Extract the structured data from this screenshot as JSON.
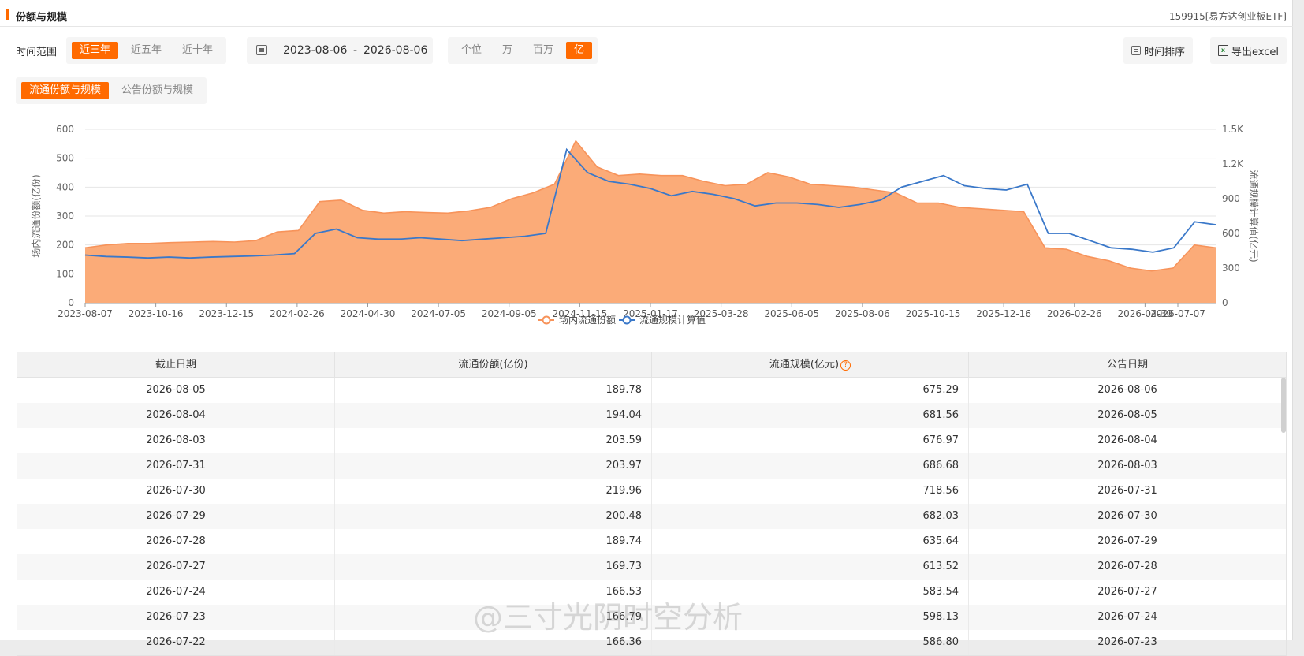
{
  "header": {
    "title": "份额与规模",
    "code": "159915[易方达创业板ETF]"
  },
  "range": {
    "label": "时间范围",
    "options": [
      "近三年",
      "近五年",
      "近十年"
    ],
    "active": 0
  },
  "date_range": {
    "start": "2023-08-06",
    "sep": "-",
    "end": "2026-08-06"
  },
  "units": {
    "options": [
      "个位",
      "万",
      "百万",
      "亿"
    ],
    "active": 3
  },
  "actions": {
    "sort": "时间排序",
    "export": "导出excel"
  },
  "chart_tabs": {
    "options": [
      "流通份额与规模",
      "公告份额与规模"
    ],
    "active": 0
  },
  "chart_data": {
    "type": "area",
    "ylabel_left": "场内流通份额(亿份)",
    "ylabel_right": "流通规模计算值(亿元)",
    "yticks_left": [
      "0",
      "100",
      "200",
      "300",
      "400",
      "500",
      "600"
    ],
    "yticks_right": [
      "0",
      "300",
      "600",
      "900",
      "1.2K",
      "1.5K"
    ],
    "ylim_left": [
      0,
      600
    ],
    "ylim_right": [
      0,
      1500
    ],
    "xticks": [
      "2023-08-07",
      "2023-10-16",
      "2023-12-15",
      "2024-02-26",
      "2024-04-30",
      "2024-07-05",
      "2024-09-05",
      "2024-11-15",
      "2025-01-17",
      "2025-03-28",
      "2025-06-05",
      "2025-08-06",
      "2025-10-15",
      "2025-12-16",
      "2026-02-26",
      "2026-04-30",
      "2026-07-07"
    ],
    "legend": [
      "场内流通份额",
      "流通规模计算值"
    ],
    "colors": {
      "share": "#f7935a",
      "share_fill": "#fbab78",
      "scale": "#3a78c9"
    },
    "series": [
      {
        "name": "场内流通份额",
        "values": [
          190,
          200,
          205,
          205,
          208,
          210,
          212,
          210,
          215,
          245,
          250,
          350,
          355,
          320,
          310,
          315,
          312,
          310,
          318,
          330,
          360,
          380,
          410,
          560,
          470,
          440,
          445,
          440,
          440,
          420,
          405,
          410,
          450,
          435,
          410,
          405,
          400,
          390,
          380,
          345,
          345,
          330,
          325,
          320,
          315,
          190,
          185,
          160,
          145,
          120,
          110,
          120,
          200,
          190
        ]
      },
      {
        "name": "流通规模计算值",
        "values": [
          165,
          160,
          158,
          155,
          158,
          155,
          158,
          160,
          162,
          165,
          170,
          240,
          255,
          225,
          220,
          220,
          225,
          220,
          215,
          220,
          225,
          230,
          240,
          530,
          450,
          420,
          410,
          395,
          370,
          385,
          375,
          360,
          335,
          345,
          345,
          340,
          330,
          340,
          355,
          400,
          420,
          440,
          405,
          395,
          390,
          410,
          240,
          240,
          215,
          190,
          185,
          175,
          190,
          280,
          270
        ]
      }
    ]
  },
  "table": {
    "columns": [
      "截止日期",
      "流通份额(亿份)",
      "流通规模(亿元)",
      "公告日期"
    ],
    "help_icon": "?",
    "rows": [
      [
        "2026-08-05",
        "189.78",
        "675.29",
        "2026-08-06"
      ],
      [
        "2026-08-04",
        "194.04",
        "681.56",
        "2026-08-05"
      ],
      [
        "2026-08-03",
        "203.59",
        "676.97",
        "2026-08-04"
      ],
      [
        "2026-07-31",
        "203.97",
        "686.68",
        "2026-08-03"
      ],
      [
        "2026-07-30",
        "219.96",
        "718.56",
        "2026-07-31"
      ],
      [
        "2026-07-29",
        "200.48",
        "682.03",
        "2026-07-30"
      ],
      [
        "2026-07-28",
        "189.74",
        "635.64",
        "2026-07-29"
      ],
      [
        "2026-07-27",
        "169.73",
        "613.52",
        "2026-07-28"
      ],
      [
        "2026-07-24",
        "166.53",
        "583.54",
        "2026-07-27"
      ],
      [
        "2026-07-23",
        "166.79",
        "598.13",
        "2026-07-24"
      ],
      [
        "2026-07-22",
        "166.36",
        "586.80",
        "2026-07-23"
      ]
    ]
  },
  "watermark": "@三寸光阴时空分析"
}
